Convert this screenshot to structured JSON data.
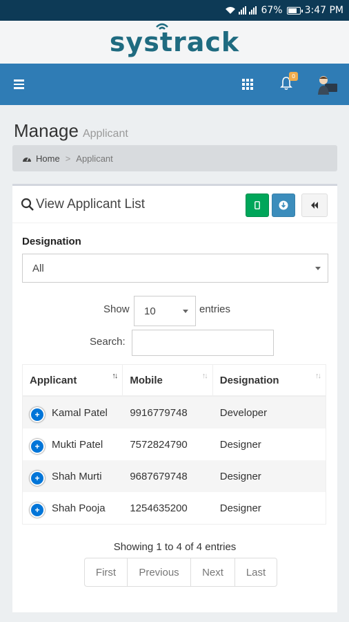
{
  "status_bar": {
    "battery": "67%",
    "time": "3:47 PM",
    "battery_level": 0.67
  },
  "brand": {
    "logo_text": "systrack",
    "logo_icon": "wifi-signal-icon"
  },
  "nav": {
    "menu_icon": "hamburger-icon",
    "apps_icon": "grid-icon",
    "notifications_icon": "bell-icon",
    "notifications_badge": "0",
    "avatar_icon": "user-avatar"
  },
  "page": {
    "title": "Manage",
    "subtitle": "Applicant"
  },
  "breadcrumb": {
    "home_icon": "dashboard-icon",
    "home": "Home",
    "separator": ">",
    "current": "Applicant"
  },
  "card": {
    "title": "View Applicant List",
    "title_icon": "search-icon",
    "buttons": [
      {
        "icon": "mobile-icon",
        "color": "#00a65a"
      },
      {
        "icon": "download-icon",
        "color": "#3c8dbc"
      },
      {
        "icon": "back-icon",
        "color": "#f4f4f4"
      }
    ]
  },
  "filter": {
    "label": "Designation",
    "value": "All"
  },
  "length": {
    "prefix": "Show",
    "value": "10",
    "suffix": "entries"
  },
  "search": {
    "label": "Search:",
    "value": ""
  },
  "table": {
    "columns": [
      "Applicant",
      "Mobile",
      "Designation"
    ],
    "rows": [
      {
        "name": "Kamal Patel",
        "mobile": "9916779748",
        "designation": "Developer"
      },
      {
        "name": "Mukti Patel",
        "mobile": "7572824790",
        "designation": "Designer"
      },
      {
        "name": "Shah Murti",
        "mobile": "9687679748",
        "designation": "Designer"
      },
      {
        "name": "Shah Pooja",
        "mobile": "1254635200",
        "designation": "Designer"
      }
    ]
  },
  "pagination": {
    "info": "Showing 1 to 4 of 4 entries",
    "first": "First",
    "previous": "Previous",
    "next": "Next",
    "last": "Last"
  },
  "colors": {
    "topbar": "#0d3a56",
    "navbar": "#2f7cb5",
    "logo": "#1f6b80",
    "primary": "#3c8dbc",
    "success": "#00a65a"
  }
}
